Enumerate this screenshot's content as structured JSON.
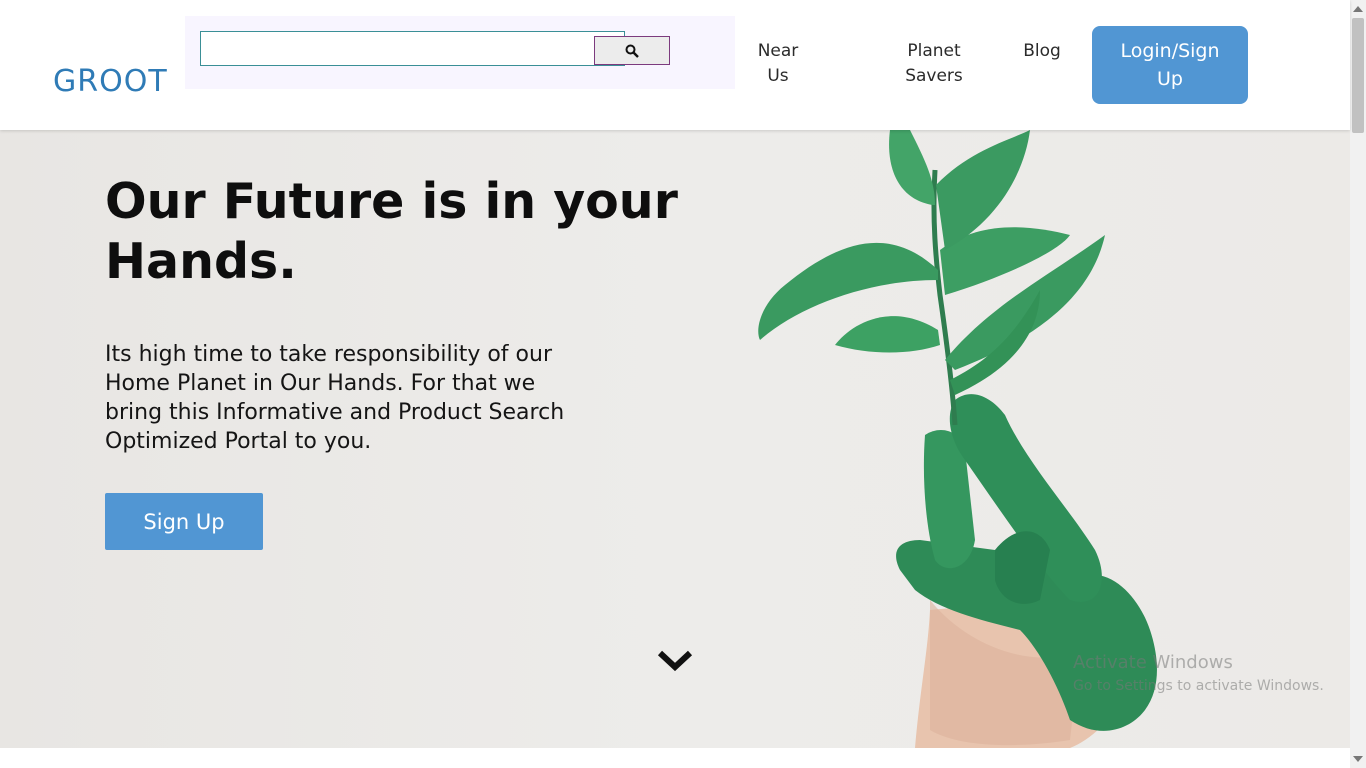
{
  "header": {
    "logo": "GROOT",
    "search": {
      "value": "",
      "placeholder": ""
    },
    "search_icon": "search-icon",
    "nav": {
      "near_us_line1": "Near",
      "near_us_line2": "Us",
      "planet_savers_line1": "Planet",
      "planet_savers_line2": "Savers",
      "blog": "Blog"
    },
    "login_line1": "Login/Sign",
    "login_line2": "Up"
  },
  "hero": {
    "title_line1": "Our Future is in your",
    "title_line2": "Hands.",
    "text_line1": "Its high time to take responsibility of our",
    "text_line2": "Home Planet in Our Hands. For that we",
    "text_line3": "bring this Informative and Product Search",
    "text_line4": "Optimized Portal to you.",
    "signup_label": "Sign Up",
    "scroll_icon": "chevron-down-icon"
  },
  "watermark": {
    "title": "Activate Windows",
    "subtitle": "Go to Settings to activate Windows."
  },
  "colors": {
    "brand": "#2f7bb6",
    "button": "#5196d3",
    "search_bg": "#f8f5ff",
    "leaf_green": "#3a8f5a"
  }
}
